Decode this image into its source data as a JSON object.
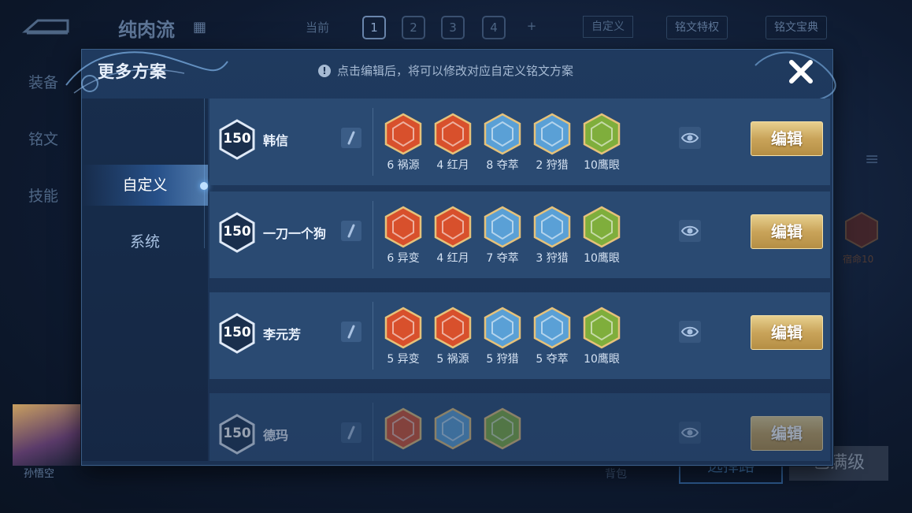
{
  "background": {
    "title": "纯肉流",
    "current_label": "当前",
    "slots": [
      "1",
      "2",
      "3",
      "4",
      "+"
    ],
    "custom_label": "自定义",
    "privilege_label": "铭文特权",
    "codex_label": "铭文宝典",
    "side_items": [
      "装备",
      "铭文",
      "技能"
    ],
    "hero_name": "孙悟空",
    "bag_label": "背包",
    "button1": "选择路",
    "button2": "已满级",
    "rune_label": "宿命10"
  },
  "modal": {
    "title": "更多方案",
    "hint": "点击编辑后，将可以修改对应自定义铭文方案",
    "tabs": [
      {
        "label": "自定义",
        "active": true
      },
      {
        "label": "系统",
        "active": false
      }
    ],
    "edit_label": "编辑",
    "rows": [
      {
        "level": "150",
        "name": "韩信",
        "runes": [
          {
            "label": "6 祸源",
            "color": "#d8502c"
          },
          {
            "label": "4 红月",
            "color": "#d8502c"
          },
          {
            "label": "8 夺萃",
            "color": "#5aa0d6"
          },
          {
            "label": "2 狩猎",
            "color": "#5aa0d6"
          },
          {
            "label": "10鹰眼",
            "color": "#7fae3c"
          }
        ]
      },
      {
        "level": "150",
        "name": "一刀一个狗",
        "runes": [
          {
            "label": "6 异变",
            "color": "#d8502c"
          },
          {
            "label": "4 红月",
            "color": "#d8502c"
          },
          {
            "label": "7 夺萃",
            "color": "#5aa0d6"
          },
          {
            "label": "3 狩猎",
            "color": "#5aa0d6"
          },
          {
            "label": "10鹰眼",
            "color": "#7fae3c"
          }
        ]
      },
      {
        "level": "150",
        "name": "李元芳",
        "runes": [
          {
            "label": "5 异变",
            "color": "#d8502c"
          },
          {
            "label": "5 祸源",
            "color": "#d8502c"
          },
          {
            "label": "5 狩猎",
            "color": "#5aa0d6"
          },
          {
            "label": "5 夺萃",
            "color": "#5aa0d6"
          },
          {
            "label": "10鹰眼",
            "color": "#7fae3c"
          }
        ]
      },
      {
        "level": "150",
        "name": "德玛",
        "runes": [
          {
            "label": "",
            "color": "#d8502c"
          },
          {
            "label": "",
            "color": "#5aa0d6"
          },
          {
            "label": "",
            "color": "#7fae3c"
          }
        ]
      }
    ]
  }
}
